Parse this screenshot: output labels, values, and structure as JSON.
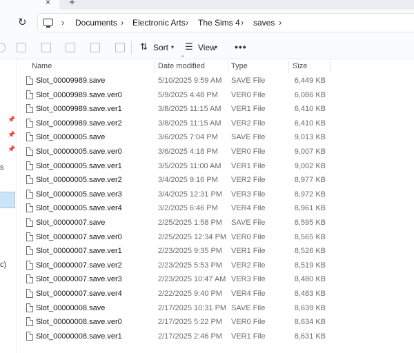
{
  "window": {
    "tab_close": "×",
    "new_tab": "+"
  },
  "address": {
    "refresh": "↻",
    "breadcrumbs": [
      "Documents",
      "Electronic Arts",
      "The Sims 4",
      "saves"
    ],
    "separator": "›"
  },
  "toolbar": {
    "sort_label": "Sort",
    "view_label": "View",
    "more_label": "•••"
  },
  "nav": {
    "partial_labels": [
      "s",
      "c)"
    ]
  },
  "columns": {
    "name": "Name",
    "date": "Date modified",
    "type": "Type",
    "size": "Size"
  },
  "files": [
    {
      "name": "Slot_00009989.save",
      "date": "5/10/2025 9:59 AM",
      "type": "SAVE File",
      "size": "6,449 KB"
    },
    {
      "name": "Slot_00009989.save.ver0",
      "date": "5/9/2025 4:48 PM",
      "type": "VER0 File",
      "size": "6,086 KB"
    },
    {
      "name": "Slot_00009989.save.ver1",
      "date": "3/8/2025 11:15 AM",
      "type": "VER1 File",
      "size": "6,410 KB"
    },
    {
      "name": "Slot_00009989.save.ver2",
      "date": "3/8/2025 11:15 AM",
      "type": "VER2 File",
      "size": "6,410 KB"
    },
    {
      "name": "Slot_00000005.save",
      "date": "3/6/2025 7:04 PM",
      "type": "SAVE File",
      "size": "9,013 KB"
    },
    {
      "name": "Slot_00000005.save.ver0",
      "date": "3/6/2025 4:18 PM",
      "type": "VER0 File",
      "size": "9,007 KB"
    },
    {
      "name": "Slot_00000005.save.ver1",
      "date": "3/5/2025 11:00 AM",
      "type": "VER1 File",
      "size": "9,002 KB"
    },
    {
      "name": "Slot_00000005.save.ver2",
      "date": "3/4/2025 9:16 PM",
      "type": "VER2 File",
      "size": "8,977 KB"
    },
    {
      "name": "Slot_00000005.save.ver3",
      "date": "3/4/2025 12:31 PM",
      "type": "VER3 File",
      "size": "8,972 KB"
    },
    {
      "name": "Slot_00000005.save.ver4",
      "date": "3/2/2025 6:46 PM",
      "type": "VER4 File",
      "size": "8,961 KB"
    },
    {
      "name": "Slot_00000007.save",
      "date": "2/25/2025 1:58 PM",
      "type": "SAVE File",
      "size": "8,595 KB"
    },
    {
      "name": "Slot_00000007.save.ver0",
      "date": "2/25/2025 12:34 PM",
      "type": "VER0 File",
      "size": "8,565 KB"
    },
    {
      "name": "Slot_00000007.save.ver1",
      "date": "2/23/2025 9:35 PM",
      "type": "VER1 File",
      "size": "8,526 KB"
    },
    {
      "name": "Slot_00000007.save.ver2",
      "date": "2/23/2025 5:53 PM",
      "type": "VER2 File",
      "size": "8,519 KB"
    },
    {
      "name": "Slot_00000007.save.ver3",
      "date": "2/23/2025 10:47 AM",
      "type": "VER3 File",
      "size": "8,480 KB"
    },
    {
      "name": "Slot_00000007.save.ver4",
      "date": "2/22/2025 9:40 PM",
      "type": "VER4 File",
      "size": "8,483 KB"
    },
    {
      "name": "Slot_00000008.save",
      "date": "2/17/2025 10:31 PM",
      "type": "SAVE File",
      "size": "8,639 KB"
    },
    {
      "name": "Slot_00000008.save.ver0",
      "date": "2/17/2025 5:22 PM",
      "type": "VER0 File",
      "size": "8,634 KB"
    },
    {
      "name": "Slot_00000008.save.ver1",
      "date": "2/17/2025 2:46 PM",
      "type": "VER1 File",
      "size": "8,631 KB"
    }
  ]
}
